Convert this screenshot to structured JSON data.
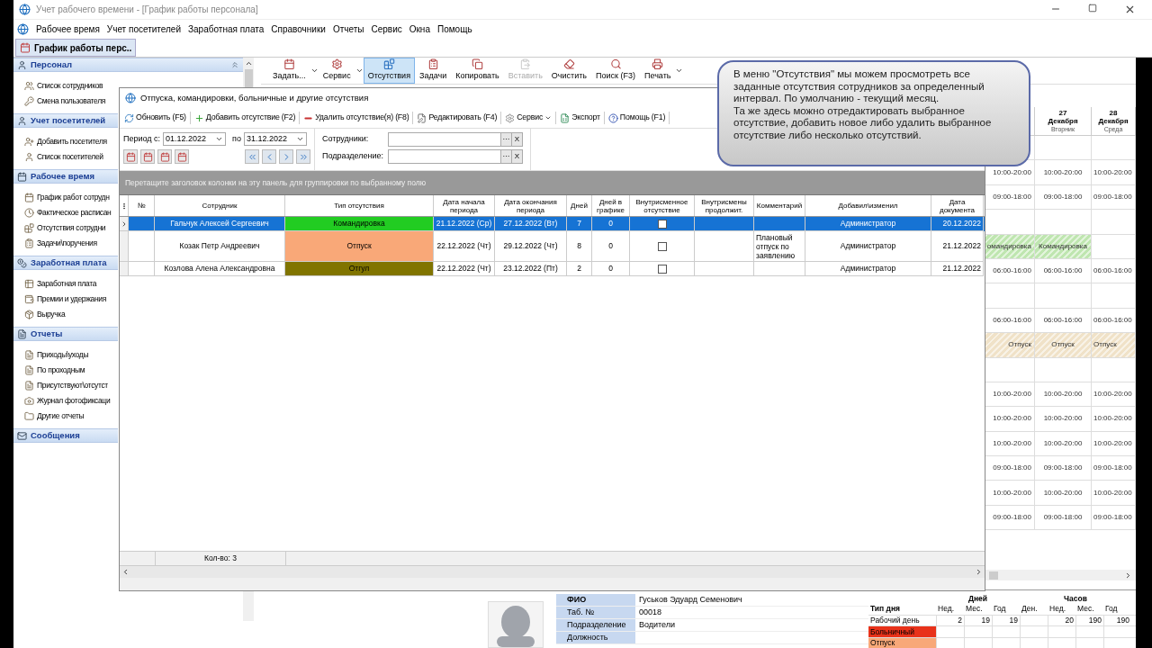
{
  "window": {
    "title": "Учет рабочего времени - [График работы персонала]"
  },
  "menu": [
    "Рабочее время",
    "Учет посетителей",
    "Заработная плата",
    "Справочники",
    "Отчеты",
    "Сервис",
    "Окна",
    "Помощь"
  ],
  "doc_tab": {
    "label": "График работы перс..",
    "selected": true
  },
  "sidebar": {
    "groups": [
      {
        "title": "Персонал",
        "items": [
          "Список сотрудников",
          "Смена пользователя"
        ]
      },
      {
        "title": "Учет посетителей",
        "items": [
          "Добавить посетителя",
          "Список посетителей"
        ]
      },
      {
        "title": "Рабочее время",
        "items": [
          "График работ сотрудн",
          "Фактическое расписан",
          "Отсутствия сотрудни",
          "Задачи\\поручения"
        ]
      },
      {
        "title": "Заработная плата",
        "items": [
          "Заработная плата",
          "Премии и удержания",
          "Выручка"
        ]
      },
      {
        "title": "Отчеты",
        "items": [
          "Приходы\\уходы",
          "По проходным",
          "Присутствуют\\отсутст",
          "Журнал фотофиксаци",
          "Другие отчеты"
        ]
      },
      {
        "title": "Сообщения"
      }
    ]
  },
  "toolbar": [
    {
      "label": "Задать...",
      "selected": false,
      "disabled": false,
      "dropdown": true
    },
    {
      "label": "Сервис",
      "selected": false,
      "disabled": false,
      "dropdown": true
    },
    {
      "label": "Отсутствия",
      "selected": true,
      "disabled": false,
      "dropdown": false
    },
    {
      "label": "Задачи",
      "selected": false,
      "disabled": false,
      "dropdown": false
    },
    {
      "label": "Копировать",
      "selected": false,
      "disabled": false,
      "dropdown": false
    },
    {
      "label": "Вставить",
      "selected": false,
      "disabled": true,
      "dropdown": false
    },
    {
      "label": "Очистить",
      "selected": false,
      "disabled": false,
      "dropdown": false
    },
    {
      "label": "Поиск (F3)",
      "selected": false,
      "disabled": false,
      "dropdown": false
    },
    {
      "label": "Печать",
      "selected": false,
      "disabled": false,
      "dropdown": true
    }
  ],
  "schedule": {
    "headers": [
      {
        "day": "27",
        "month": "Декабря",
        "weekday": "Вторник"
      },
      {
        "day": "28",
        "month": "Декабря",
        "weekday": "Среда"
      }
    ],
    "rows": [
      [
        {},
        {},
        {}
      ],
      [
        {
          "text": "10:00-20:00"
        },
        {
          "text": "10:00-20:00"
        },
        {
          "text": "10:00-20:00"
        }
      ],
      [
        {
          "text": "09:00-18:00"
        },
        {
          "text": "09:00-18:00"
        },
        {
          "text": "09:00-18:00"
        }
      ],
      [
        {},
        {},
        {}
      ],
      [
        {
          "text": "омандировка",
          "color": "#bfe6b0"
        },
        {
          "text": "Командировка",
          "color": "#bfe6b0"
        },
        {}
      ],
      [
        {
          "text": "06:00-16:00"
        },
        {
          "text": "06:00-16:00"
        },
        {
          "text": "06:00-16:00"
        }
      ],
      [
        {},
        {},
        {}
      ],
      [
        {
          "text": "06:00-16:00"
        },
        {
          "text": "06:00-16:00"
        },
        {
          "text": "06:00-16:00"
        }
      ],
      [
        {
          "text": "Отпуск",
          "color": "#f0e2c8"
        },
        {
          "text": "Отпуск",
          "color": "#f0e2c8"
        },
        {
          "text": "Отпуск",
          "color": "#f0e2c8"
        }
      ],
      [
        {},
        {},
        {}
      ],
      [
        {
          "text": "10:00-20:00"
        },
        {
          "text": "10:00-20:00"
        },
        {
          "text": "10:00-20:00"
        }
      ],
      [
        {
          "text": "10:00-20:00"
        },
        {
          "text": "10:00-20:00"
        },
        {
          "text": "10:00-20:00"
        }
      ],
      [
        {
          "text": "10:00-20:00"
        },
        {
          "text": "10:00-20:00"
        },
        {
          "text": "10:00-20:00"
        }
      ],
      [
        {
          "text": "09:00-18:00"
        },
        {
          "text": "09:00-18:00"
        },
        {
          "text": "09:00-18:00"
        }
      ],
      [
        {
          "text": "10:00-20:00"
        },
        {
          "text": "10:00-20:00"
        },
        {
          "text": "10:00-20:00"
        }
      ],
      [
        {
          "text": "09:00-18:00"
        },
        {
          "text": "09:00-18:00"
        },
        {
          "text": "09:00-18:00"
        }
      ]
    ]
  },
  "employee_card": {
    "fields": [
      {
        "label": "ФИО",
        "value": "Гуськов Эдуард Семенович"
      },
      {
        "label": "Таб. №",
        "value": "00018"
      },
      {
        "label": "Подразделение",
        "value": "Водители"
      },
      {
        "label": "Должность"
      }
    ]
  },
  "day_types": {
    "groups": [
      "Дней",
      "Часов"
    ],
    "columns": [
      "Тип дня",
      "Нед.",
      "Мес.",
      "Год",
      "Ден.",
      "Нед.",
      "Мес.",
      "Год"
    ],
    "rows": [
      {
        "name": "Рабочий день",
        "days": [
          "2",
          "19",
          "19"
        ],
        "hours": [
          "20",
          "190",
          "190"
        ]
      },
      {
        "name": "Больничный",
        "color": "#e8321a"
      },
      {
        "name": "Отпуск",
        "color": "#f8a878"
      }
    ]
  },
  "absences": {
    "title": "Отпуска, командировки, больничные и другие отсутствия",
    "toolbar": [
      "Обновить (F5)",
      "Добавить отсутствие (F2)",
      "Удалить отсутствие(я) (F8)",
      "Редактировать (F4)",
      "Сервис",
      "Экспорт",
      "Помощь (F1)"
    ],
    "period_from_label": "Период с:",
    "period_from": "01.12.2022",
    "period_to_label": "по",
    "period_to": "31.12.2022",
    "filters": [
      {
        "label": "Сотрудники:",
        "ellipsis": "···",
        "clear": "X"
      },
      {
        "label": "Подразделение:",
        "ellipsis": "···",
        "clear": "X"
      }
    ],
    "group_hint": "Перетащите заголовок колонки на эту панель для группировки по выбранному полю",
    "columns": [
      "№",
      "Сотрудник",
      "Тип отсутствия",
      "Дата начала периода",
      "Дата окончания периода",
      "Дней",
      "Дней в графике",
      "Внутрисменное отсутствие",
      "Внутрисмены продолжит.",
      "Комментарий",
      "Добавил\\изменил",
      "Дата документа"
    ],
    "rows": [
      {
        "selected": true,
        "employee": "Гальчук Алексей Сергеевич",
        "type": "Командировка",
        "color": "#22cc22",
        "start": "21.12.2022 (Ср)",
        "end": "27.12.2022 (Вт)",
        "days": "7",
        "days_in_schedule": "0",
        "intrashift": false,
        "added_by": "Администратор",
        "doc_date": "20.12.2022"
      },
      {
        "selected": false,
        "employee": "Козак Петр Андреевич",
        "type": "Отпуск",
        "color": "#f9a878",
        "start": "22.12.2022 (Чт)",
        "end": "29.12.2022 (Чт)",
        "days": "8",
        "days_in_schedule": "0",
        "intrashift": false,
        "comment": "Плановый отпуск по заявлению",
        "added_by": "Администратор",
        "doc_date": "21.12.2022"
      },
      {
        "selected": false,
        "employee": "Козлова Алена Александровна",
        "type": "Отгул",
        "color": "#807400",
        "start": "22.12.2022 (Чт)",
        "end": "23.12.2022 (Пт)",
        "days": "2",
        "days_in_schedule": "0",
        "intrashift": false,
        "added_by": "Администратор",
        "doc_date": "21.12.2022"
      }
    ],
    "count": "Кол-во: 3"
  },
  "callout": {
    "lines": [
      "В меню \"Отсутствия\" мы можем просмотреть все заданные отсутствия сотрудников за определенный интервал. По умолчанию - текущий месяц.",
      "Та же здесь можно отредактировать выбранное отсутствие, добавить новое либо удалить выбранное отсутствие либо несколько отсутствий."
    ]
  }
}
